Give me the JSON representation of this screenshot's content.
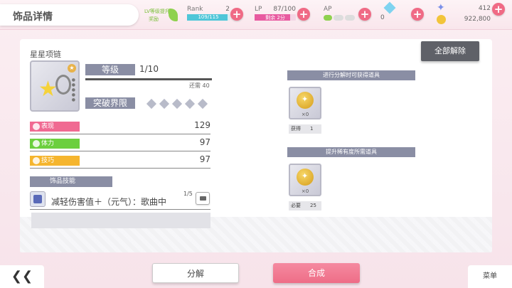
{
  "header": {
    "title": "饰品详情",
    "stamina_label_1": "LV等级提升",
    "stamina_label_2": "奖励",
    "rank": {
      "label": "Rank",
      "value": "2",
      "progress_text": "109/115",
      "progress": 0.95
    },
    "lp": {
      "label": "LP",
      "value": "87/100",
      "sub_text": "剩余 2分",
      "progress": 0.87
    },
    "ap": {
      "label": "AP"
    },
    "gems": "0",
    "star_gems": "412",
    "coins": "922,800"
  },
  "item": {
    "name": "星星项链",
    "level_label": "等级",
    "level_value": "1/10",
    "remaining": "还需 40",
    "break_label": "突破界限",
    "break_count": 5,
    "badge_glyph": "★"
  },
  "stats": [
    {
      "label": "表现",
      "value": "129",
      "color": "#f06a92"
    },
    {
      "label": "体力",
      "value": "97",
      "color": "#6ccf3e"
    },
    {
      "label": "技巧",
      "value": "97",
      "color": "#f5b52e"
    }
  ],
  "skill": {
    "section_label": "饰品技能",
    "text": "减轻伤害值＋（元气）：歌曲中",
    "count": "1/5"
  },
  "buttons": {
    "unlock_all": "全部解除",
    "back": "❮❮",
    "dismantle": "分解",
    "craft": "合成",
    "menu": "菜单"
  },
  "dismantle_section": {
    "header": "进行分解时可获得道具",
    "item_qty": "×0",
    "info_label": "获得",
    "info_value": "1"
  },
  "upgrade_section": {
    "header": "提升稀有度所需道具",
    "item_qty": "×0",
    "info_label": "必要",
    "info_value": "25"
  },
  "colors": {
    "accent": "#f06a85",
    "tag_gray": "#8a8ea4",
    "rank_bar": "#4fc6d8",
    "lp_bar": "#e85aa0"
  }
}
